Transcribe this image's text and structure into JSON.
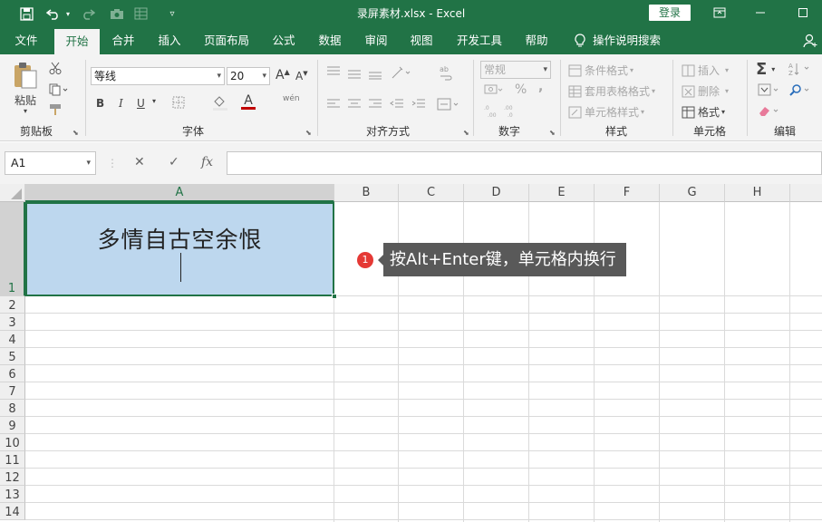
{
  "window": {
    "title": "录屏素材.xlsx  -  Excel",
    "login_label": "登录"
  },
  "quick_access": {
    "save": "save-icon",
    "undo": "undo-icon",
    "redo": "redo-icon",
    "camera": "camera-icon",
    "form": "form-icon",
    "customize": "customize-icon"
  },
  "tabs": [
    {
      "label": "文件"
    },
    {
      "label": "开始"
    },
    {
      "label": "合并"
    },
    {
      "label": "插入"
    },
    {
      "label": "页面布局"
    },
    {
      "label": "公式"
    },
    {
      "label": "数据"
    },
    {
      "label": "审阅"
    },
    {
      "label": "视图"
    },
    {
      "label": "开发工具"
    },
    {
      "label": "帮助"
    }
  ],
  "tell_me": "操作说明搜索",
  "ribbon": {
    "clipboard": {
      "paste": "粘贴",
      "label": "剪贴板"
    },
    "font": {
      "name": "等线",
      "size": "20",
      "label": "字体",
      "bold": "B",
      "italic": "I",
      "underline": "U",
      "grow": "A",
      "shrink": "A",
      "color": "A",
      "phonetic": "wén"
    },
    "alignment": {
      "label": "对齐方式"
    },
    "number": {
      "format": "常规",
      "percent": "%",
      "comma": ",",
      "label": "数字"
    },
    "styles": {
      "conditional": "条件格式",
      "table": "套用表格格式",
      "cell": "单元格样式",
      "label": "样式"
    },
    "cells": {
      "insert": "插入",
      "delete": "删除",
      "format": "格式",
      "label": "单元格"
    },
    "editing": {
      "label": "编辑"
    }
  },
  "formula_bar": {
    "name_box": "A1",
    "cancel": "✕",
    "enter": "✓",
    "fx": "fx",
    "content": ""
  },
  "sheet": {
    "columns": [
      "A",
      "B",
      "C",
      "D",
      "E",
      "F",
      "G",
      "H"
    ],
    "rows": [
      "1",
      "2",
      "3",
      "4",
      "5",
      "6",
      "7",
      "8",
      "9",
      "10",
      "11",
      "12",
      "13",
      "14"
    ],
    "cell_a1_text": "多情自古空余恨"
  },
  "annotation": {
    "number": "1",
    "text": "按Alt+Enter键，单元格内换行"
  },
  "colors": {
    "excel_green": "#217346",
    "selected_cell": "#bdd7ee",
    "callout": "#595959",
    "badge": "#e53935"
  }
}
